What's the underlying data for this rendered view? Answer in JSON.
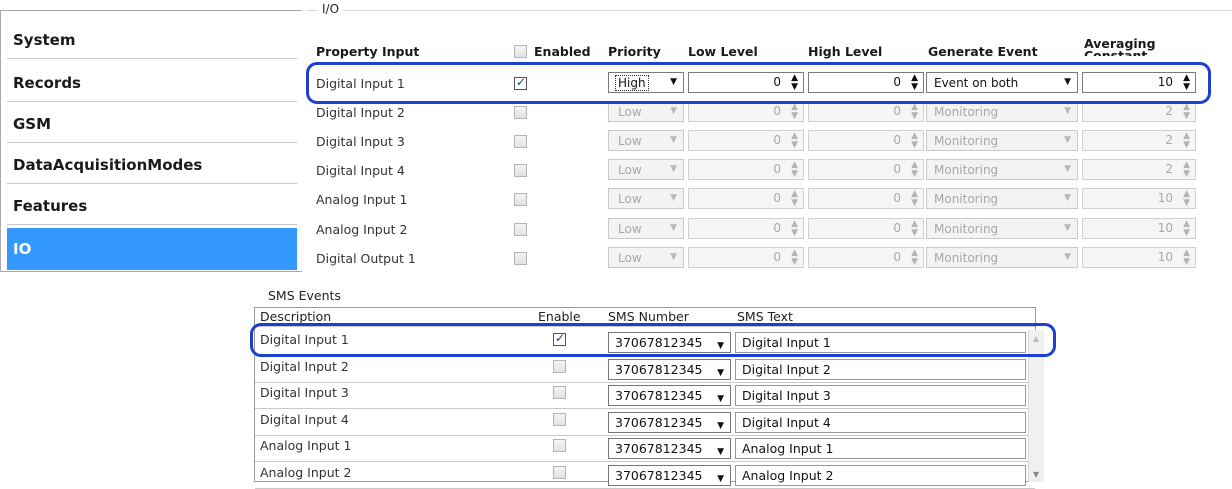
{
  "sidebar": {
    "items": [
      {
        "label": "System",
        "selected": false
      },
      {
        "label": "Records",
        "selected": false
      },
      {
        "label": "GSM",
        "selected": false
      },
      {
        "label": "DataAcquisitionModes",
        "selected": false
      },
      {
        "label": "Features",
        "selected": false
      },
      {
        "label": "IO",
        "selected": true
      }
    ]
  },
  "io": {
    "legend": "I/O",
    "headers": {
      "property": "Property Input",
      "enabled": "Enabled",
      "priority": "Priority",
      "low": "Low Level",
      "high": "High Level",
      "event": "Generate Event",
      "averaging": "Averaging Constant"
    },
    "rows": [
      {
        "name": "Digital Input 1",
        "enabled": true,
        "priority": "High",
        "low": "0",
        "high": "0",
        "event": "Event on both",
        "avg": "10"
      },
      {
        "name": "Digital Input 2",
        "enabled": false,
        "priority": "Low",
        "low": "0",
        "high": "0",
        "event": "Monitoring",
        "avg": "2"
      },
      {
        "name": "Digital Input 3",
        "enabled": false,
        "priority": "Low",
        "low": "0",
        "high": "0",
        "event": "Monitoring",
        "avg": "2"
      },
      {
        "name": "Digital Input 4",
        "enabled": false,
        "priority": "Low",
        "low": "0",
        "high": "0",
        "event": "Monitoring",
        "avg": "2"
      },
      {
        "name": "Analog Input 1",
        "enabled": false,
        "priority": "Low",
        "low": "0",
        "high": "0",
        "event": "Monitoring",
        "avg": "10"
      },
      {
        "name": "Analog Input 2",
        "enabled": false,
        "priority": "Low",
        "low": "0",
        "high": "0",
        "event": "Monitoring",
        "avg": "10"
      },
      {
        "name": "Digital Output 1",
        "enabled": false,
        "priority": "Low",
        "low": "0",
        "high": "0",
        "event": "Monitoring",
        "avg": "10"
      }
    ]
  },
  "sms": {
    "title": "SMS Events",
    "headers": {
      "description": "Description",
      "enable": "Enable",
      "number": "SMS Number",
      "text": "SMS Text"
    },
    "rows": [
      {
        "description": "Digital Input 1",
        "enabled": true,
        "number": "37067812345",
        "text": "Digital Input 1"
      },
      {
        "description": "Digital Input 2",
        "enabled": false,
        "number": "37067812345",
        "text": "Digital Input 2"
      },
      {
        "description": "Digital Input 3",
        "enabled": false,
        "number": "37067812345",
        "text": "Digital Input 3"
      },
      {
        "description": "Digital Input 4",
        "enabled": false,
        "number": "37067812345",
        "text": "Digital Input 4"
      },
      {
        "description": "Analog Input 1",
        "enabled": false,
        "number": "37067812345",
        "text": "Analog Input 1"
      },
      {
        "description": "Analog Input 2",
        "enabled": false,
        "number": "37067812345",
        "text": "Analog Input 2"
      }
    ]
  },
  "icons": {
    "check": "✓",
    "dropdown": "▼",
    "spin": "▲▼"
  },
  "colors": {
    "selection": "#3399ff",
    "highlight": "#1f3fd0"
  }
}
